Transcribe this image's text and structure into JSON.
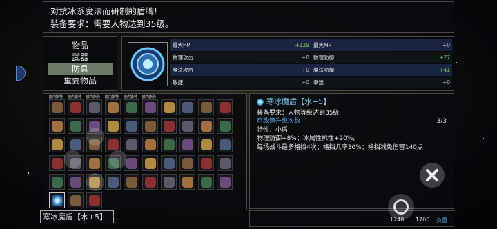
{
  "description": {
    "line1": "对抗冰系魔法而研制的盾牌!",
    "line2": "装备要求：需要人物达到35级。"
  },
  "categories": [
    {
      "label": "物品",
      "active": false
    },
    {
      "label": "武器",
      "active": false
    },
    {
      "label": "防具",
      "active": true
    },
    {
      "label": "重要物品",
      "active": false
    }
  ],
  "stats": [
    {
      "left": {
        "label": "最大HP",
        "value": "+129"
      },
      "right": {
        "label": "最大MP",
        "value": "+0"
      }
    },
    {
      "left": {
        "label": "物理攻击",
        "value": "+0"
      },
      "right": {
        "label": "物理防御",
        "value": "+27"
      }
    },
    {
      "left": {
        "label": "魔法攻击",
        "value": "+0"
      },
      "right": {
        "label": "魔法防御",
        "value": "+41"
      }
    },
    {
      "left": {
        "label": "敏捷",
        "value": "+0"
      },
      "right": {
        "label": "幸运",
        "value": "+0"
      }
    }
  ],
  "inventory": {
    "short_labels": [
      "欧内斯特",
      "欧内斯特",
      "欧内斯特",
      "欧内斯特",
      "欧内斯特",
      "欧内斯特"
    ],
    "selected_name": "寒冰魔盾【水+5】"
  },
  "detail": {
    "title": "寒冰魔盾【水+5】",
    "req": "装备要求：人物等级达到35级",
    "upgrade": "可改造升级次数",
    "upgrade_count": "3/3",
    "trait": "特性：小盾",
    "effect1": "物理防御+8%；冰属性抗性+20%;",
    "effect2": "每场战斗最多格挡4次；格挡几率30%；格挡减免伤害140点"
  },
  "footer": {
    "weight": "1248",
    "max_weight": "1700",
    "load_label": "负重"
  },
  "colors": {
    "positive": "#7bd36a",
    "accent": "#5fa9e6",
    "active_tab": "#6a7a66"
  }
}
